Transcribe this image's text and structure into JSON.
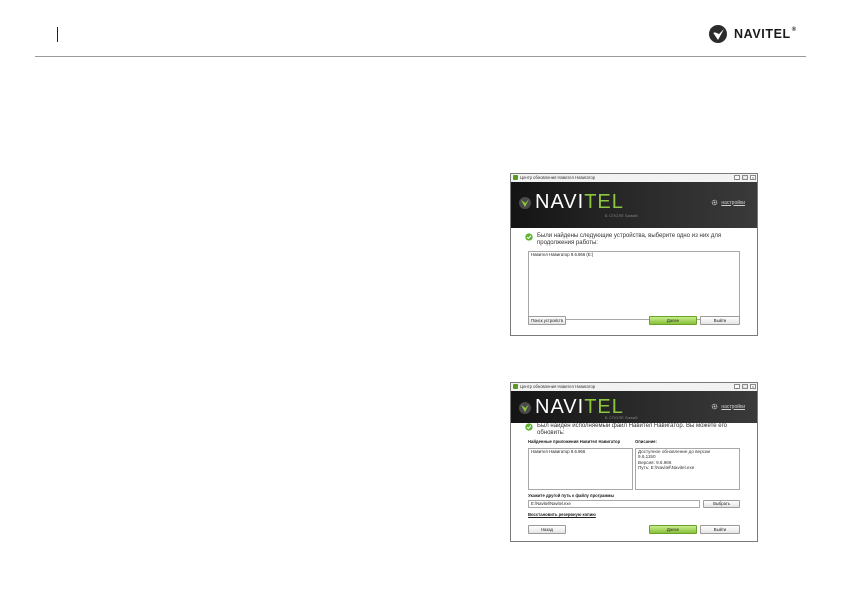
{
  "header": {
    "brand": "NAVITEL",
    "brand_mark": "®"
  },
  "windows": [
    {
      "title": "Центр обновления Навител Навигатор",
      "controls": [
        "_",
        "□",
        "×"
      ],
      "banner": {
        "logo_main": "NAVI",
        "logo_accent": "TEL",
        "subtitle": "Б СПОЛЕ Бавий",
        "settings_label": "настройки"
      },
      "message": "Были найдены следующие устройства, выберите одно из них для продолжения работы:",
      "list_items": [
        "Навител Навигатор 9.6.966 (E:)"
      ],
      "buttons": {
        "search": "Поиск устройств",
        "next": "Далее",
        "exit": "Выйти"
      }
    },
    {
      "title": "Центр обновления Навител Навигатор",
      "controls": [
        "_",
        "□",
        "×"
      ],
      "banner": {
        "logo_main": "NAVI",
        "logo_accent": "TEL",
        "subtitle": "Б СПОЛЕ Бавий",
        "settings_label": "настройки"
      },
      "message": "Был найден исполняемый файл Навител Навигатор. Вы можете его обновить:",
      "found_label": "Найденные приложения Навител Навигатор",
      "description_label": "Описание:",
      "list_items": [
        "Навител Навигатор 9.6.966"
      ],
      "description_lines": [
        "Доступное обновление до версии",
        "9.6.1150",
        "Версия: 9.6.966",
        "Путь: E:\\Navitel\\Navitel.exe"
      ],
      "path_label": "Укажите другой путь к файлу программы",
      "path_value": "E:\\Navitel\\Navitel.exe",
      "buttons": {
        "browse": "Выбрать",
        "back": "Назад",
        "next": "Далее",
        "exit": "Выйти"
      },
      "restore_link": "Восстановить резервную копию"
    }
  ]
}
